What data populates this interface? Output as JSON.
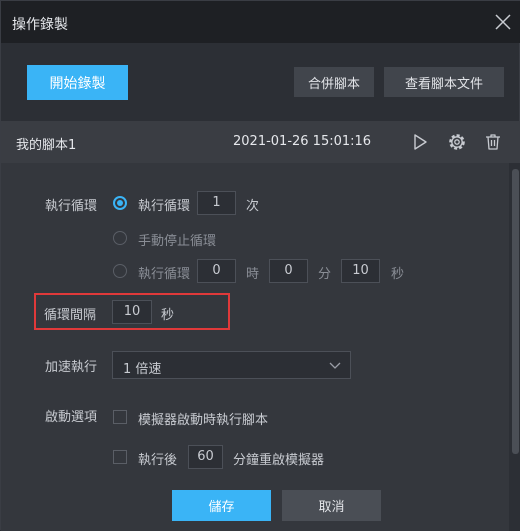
{
  "window": {
    "title": "操作錄製"
  },
  "toolbar": {
    "start_label": "開始錄製",
    "merge_label": "合併腳本",
    "view_label": "查看腳本文件"
  },
  "script": {
    "name": "我的腳本1",
    "time": "2021-01-26 15:01:16"
  },
  "icons": {
    "close": "close-icon",
    "play": "play-icon",
    "settings": "gear-icon",
    "delete": "trash-icon"
  },
  "loop": {
    "label": "執行循環",
    "option1_text": "執行循環",
    "option1_count": "1",
    "option1_unit": "次",
    "option2_text": "手動停止循環",
    "option3_text": "執行循環",
    "option3_hours": "0",
    "hours_unit": "時",
    "option3_minutes": "0",
    "minutes_unit": "分",
    "option3_seconds": "10",
    "seconds_unit": "秒"
  },
  "interval": {
    "label": "循環間隔",
    "value": "10",
    "unit": "秒"
  },
  "speed": {
    "label": "加速執行",
    "selected": "1 倍速"
  },
  "startup": {
    "label": "啟動選項",
    "opt1_text": "模擬器啟動時執行腳本",
    "opt2_prefix": "執行後",
    "opt2_value": "60",
    "opt2_suffix": "分鐘重啟模擬器"
  },
  "footer": {
    "save_label": "儲存",
    "cancel_label": "取消"
  },
  "colors": {
    "accent": "#3ab4f6",
    "highlight_border": "#e0393a",
    "background": "#2c2f35"
  }
}
